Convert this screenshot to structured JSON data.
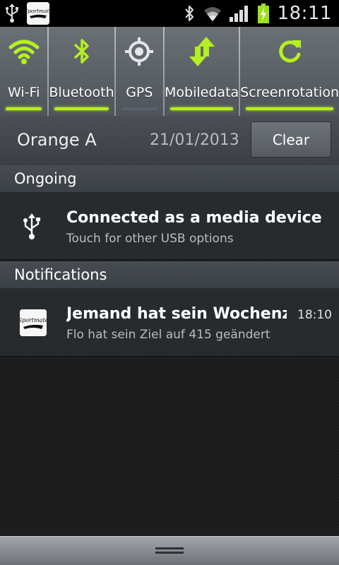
{
  "status_bar": {
    "time": "18:11",
    "app_icon_text": "Sportmate",
    "icons": [
      "usb-icon",
      "sportmate-app-icon",
      "bluetooth-icon",
      "wifi-icon",
      "signal-icon",
      "battery-charging-icon"
    ]
  },
  "quick_settings": [
    {
      "label": "Wi-Fi",
      "icon": "wifi-icon",
      "enabled": true
    },
    {
      "label": "Bluetooth",
      "icon": "bluetooth-icon",
      "enabled": true
    },
    {
      "label": "GPS",
      "icon": "gps-icon",
      "enabled": false
    },
    {
      "label": "Mobile\ndata",
      "label_line1": "Mobile",
      "label_line2": "data",
      "icon": "mobile-data-icon",
      "enabled": true
    },
    {
      "label": "Screen\nrotation",
      "label_line1": "Screen",
      "label_line2": "rotation",
      "icon": "rotation-icon",
      "enabled": true
    }
  ],
  "carrier": {
    "name": "Orange A",
    "date": "21/01/2013",
    "clear_label": "Clear"
  },
  "ongoing": {
    "header": "Ongoing",
    "items": [
      {
        "icon": "usb-icon",
        "title": "Connected as a media device",
        "subtitle": "Touch for other USB options"
      }
    ]
  },
  "notifications": {
    "header": "Notifications",
    "items": [
      {
        "icon": "sportmate-app-icon",
        "title": "Jemand hat sein Wochenziel",
        "subtitle": "Flo hat sein Ziel auf 415 geändert",
        "time": "18:10"
      }
    ]
  },
  "colors": {
    "accent_on": "#b4f020",
    "indicator_off": "#57636d"
  }
}
